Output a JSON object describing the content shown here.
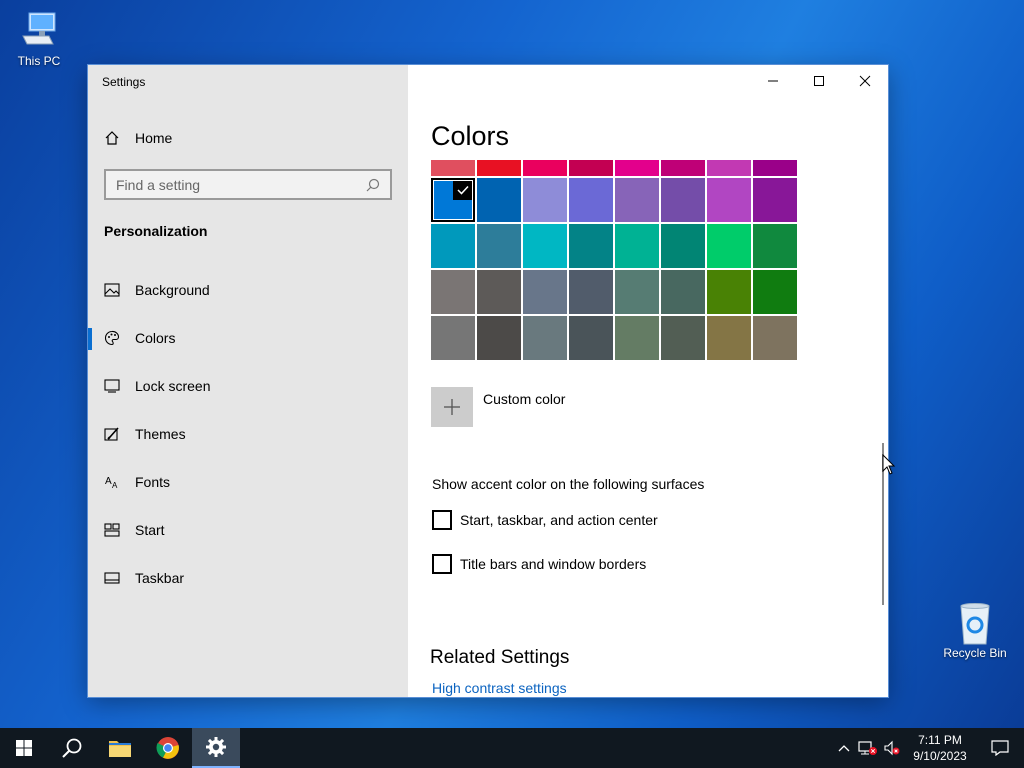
{
  "desktop": {
    "this_pc_label": "This PC",
    "recycle_bin_label": "Recycle Bin"
  },
  "window": {
    "title": "Settings"
  },
  "sidebar": {
    "home_label": "Home",
    "search_placeholder": "Find a setting",
    "section_header": "Personalization",
    "items": [
      {
        "label": "Background",
        "icon": "picture-icon",
        "active": false
      },
      {
        "label": "Colors",
        "icon": "palette-icon",
        "active": true
      },
      {
        "label": "Lock screen",
        "icon": "lock-screen-icon",
        "active": false
      },
      {
        "label": "Themes",
        "icon": "brush-icon",
        "active": false
      },
      {
        "label": "Fonts",
        "icon": "font-icon",
        "active": false
      },
      {
        "label": "Start",
        "icon": "start-icon",
        "active": false
      },
      {
        "label": "Taskbar",
        "icon": "taskbar-icon",
        "active": false
      }
    ]
  },
  "content": {
    "title": "Colors",
    "top_row_colors": [
      "#e04f5f",
      "#e81123",
      "#ea005e",
      "#c30052",
      "#e3008c",
      "#bf0077",
      "#c239b3",
      "#9a0089"
    ],
    "palette_rows": [
      [
        "#0078d7",
        "#0063b1",
        "#8e8cd8",
        "#6b69d6",
        "#8764b8",
        "#744da9",
        "#b146c2",
        "#881798"
      ],
      [
        "#0099bc",
        "#2d7d9a",
        "#00b7c3",
        "#038387",
        "#00b294",
        "#018574",
        "#00cc6a",
        "#10893e"
      ],
      [
        "#7a7574",
        "#5d5a58",
        "#68768a",
        "#515c6b",
        "#567c73",
        "#486860",
        "#498205",
        "#107c10"
      ],
      [
        "#767676",
        "#4c4a48",
        "#69797e",
        "#4a5459",
        "#647c64",
        "#525e54",
        "#847545",
        "#7e735f"
      ]
    ],
    "selected_color": "#0078d7",
    "custom_color_label": "Custom color",
    "surfaces_header": "Show accent color on the following surfaces",
    "checkboxes": [
      {
        "label": "Start, taskbar, and action center",
        "checked": false
      },
      {
        "label": "Title bars and window borders",
        "checked": false
      }
    ],
    "related_header": "Related Settings",
    "related_link": "High contrast settings"
  },
  "taskbar": {
    "time": "7:11 PM",
    "date": "9/10/2023"
  }
}
